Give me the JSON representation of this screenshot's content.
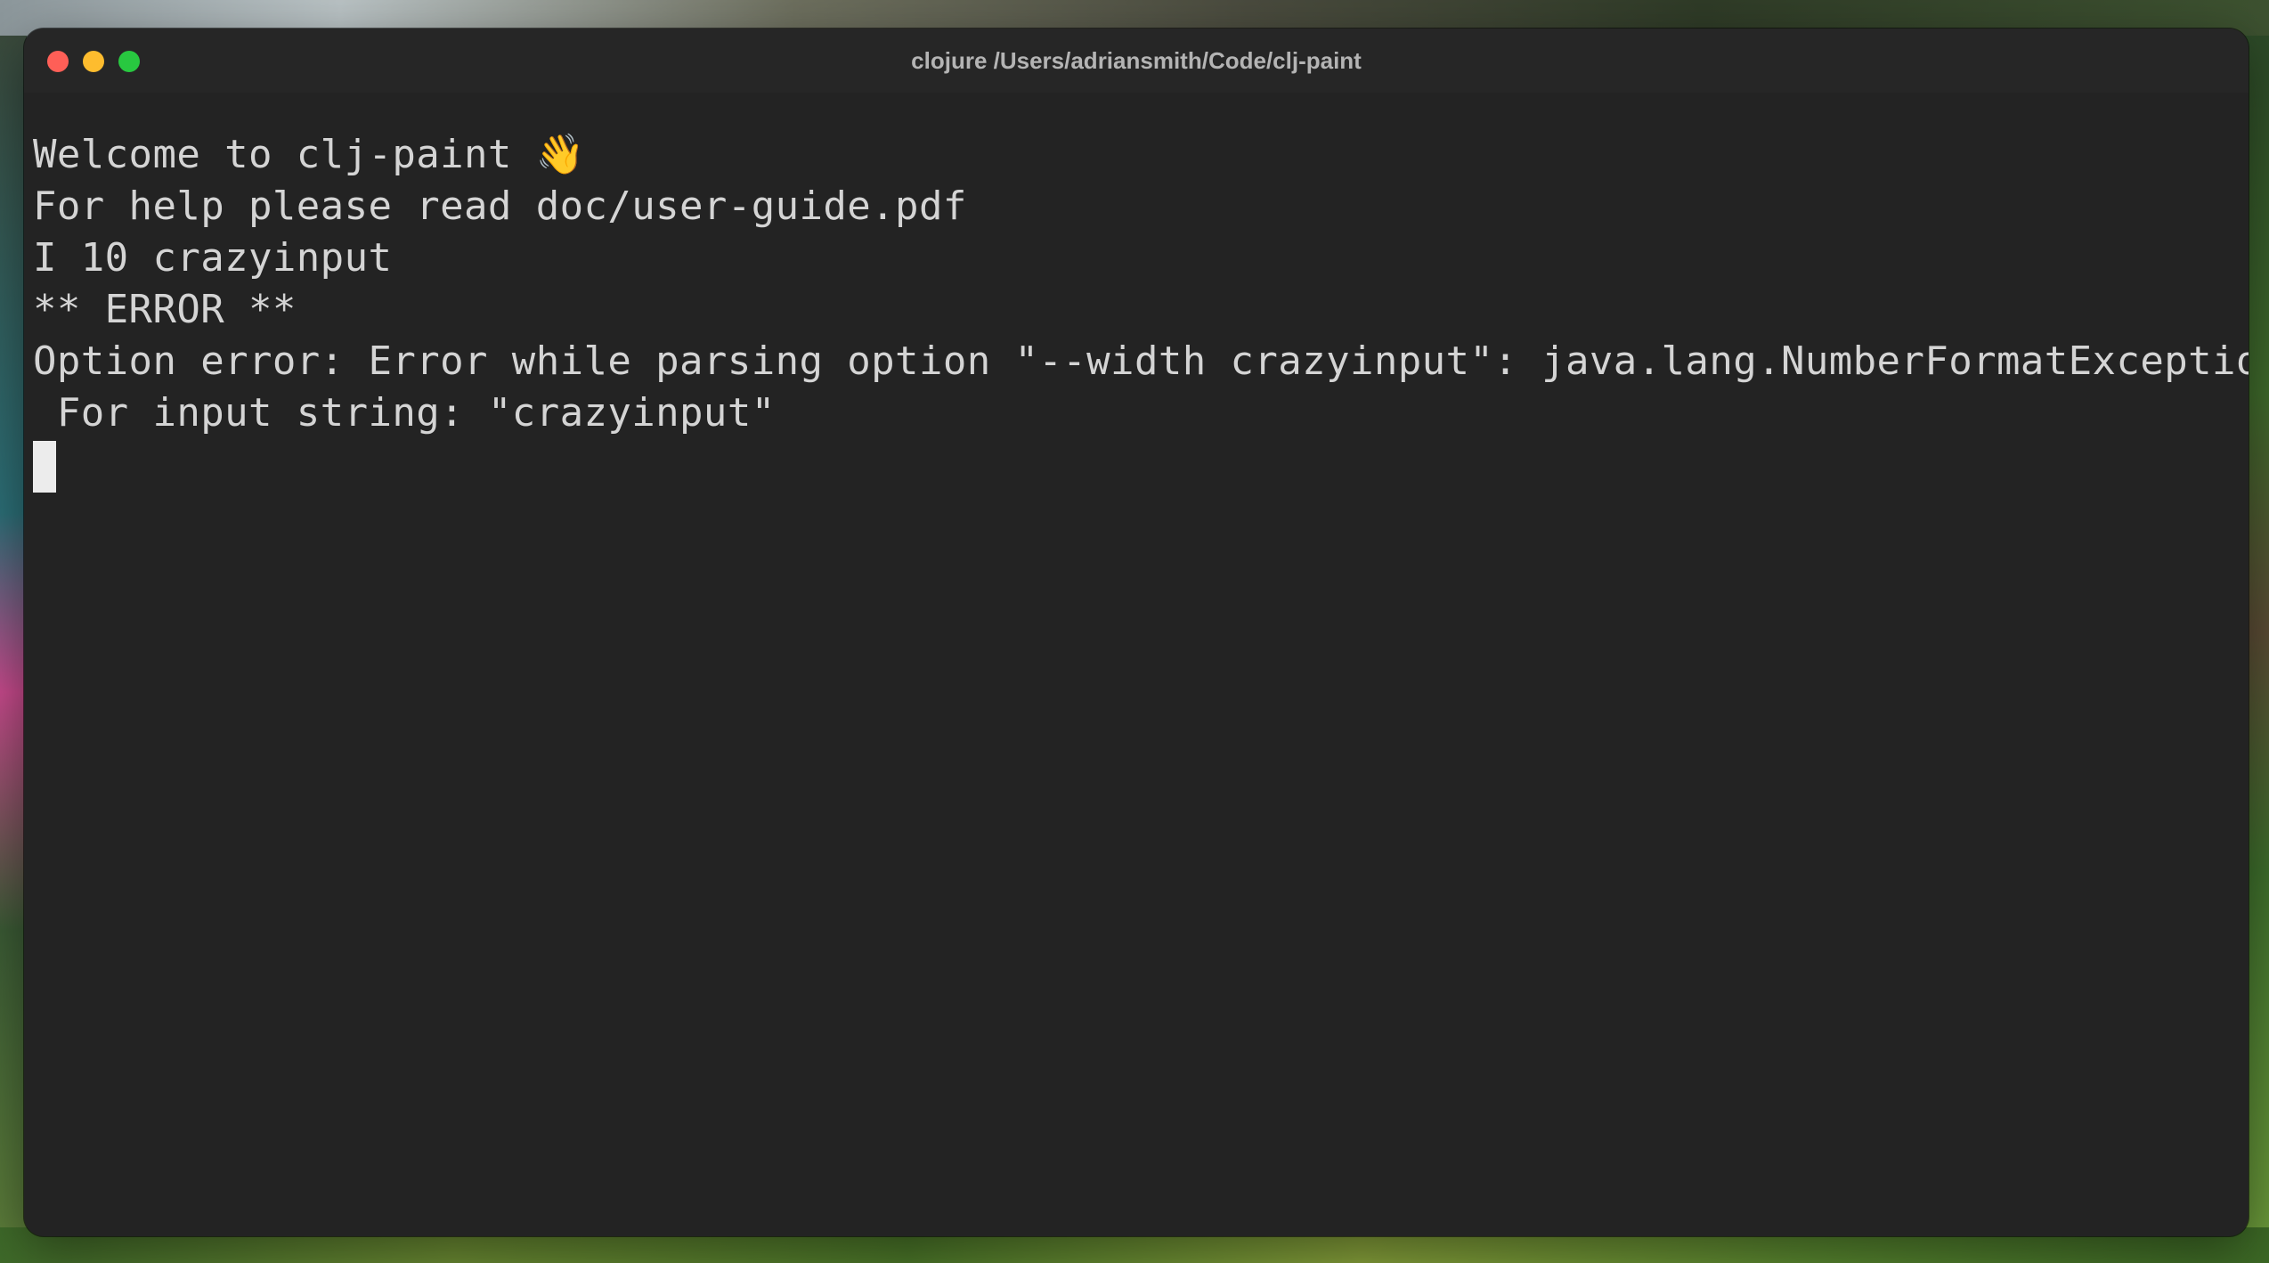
{
  "window": {
    "title": "clojure /Users/adriansmith/Code/clj-paint"
  },
  "terminal": {
    "lines": [
      {
        "text": "Welcome to clj-paint",
        "emoji": "👋"
      },
      {
        "text": "For help please read doc/user-guide.pdf"
      },
      {
        "text": "I 10 crazyinput"
      },
      {
        "text": "** ERROR **"
      },
      {
        "text": "Option error: Error while parsing option \"--width crazyinput\": java.lang.NumberFormatException:"
      },
      {
        "text": " For input string: \"crazyinput\""
      }
    ]
  },
  "colors": {
    "terminal_bg": "#232323",
    "text": "#d4d4d4",
    "close": "#fe5f57",
    "minimize": "#febc2e",
    "zoom": "#28c840"
  },
  "icons": [
    "close-icon",
    "minimize-icon",
    "zoom-icon",
    "waving-hand-icon"
  ]
}
